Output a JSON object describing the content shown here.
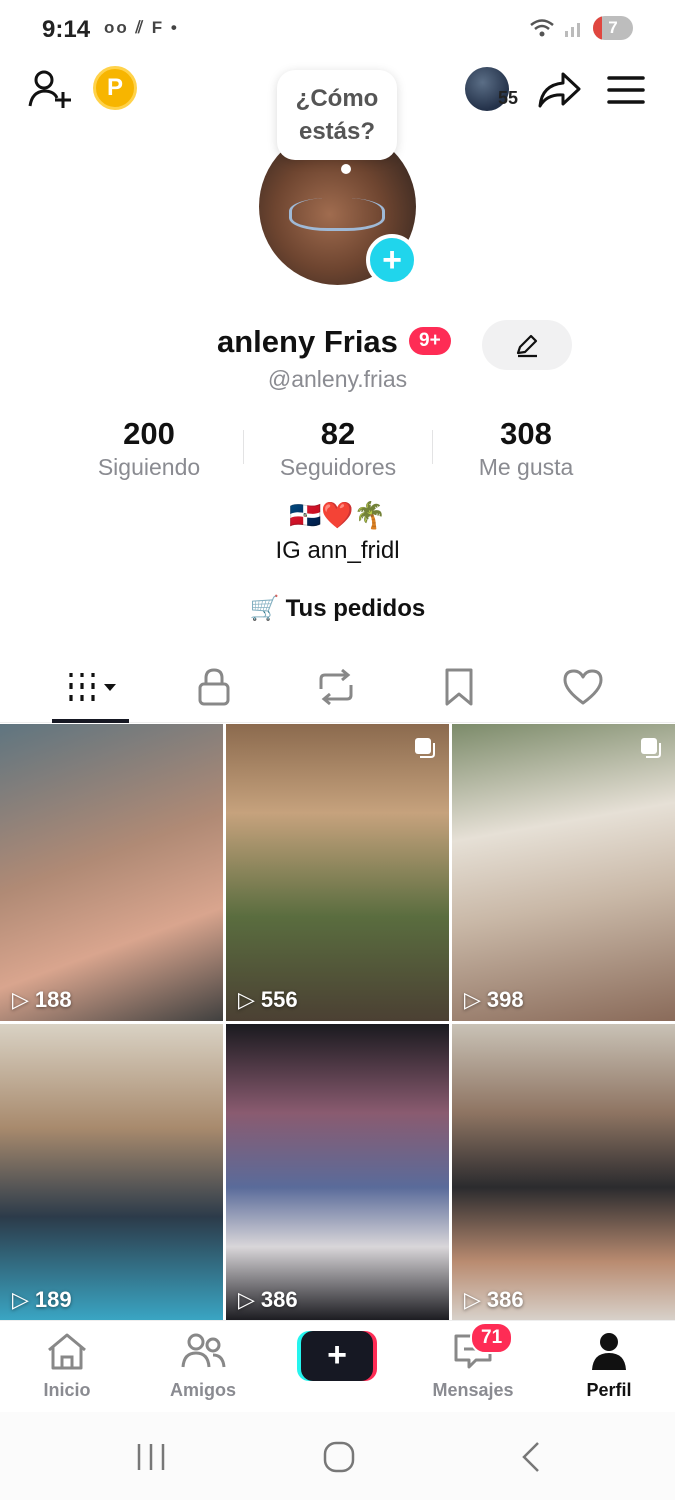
{
  "status_bar": {
    "time": "9:14",
    "left_icons": "oo ⫽ F •",
    "battery": "7"
  },
  "header": {
    "coin_label": "P",
    "visitors_count": "55"
  },
  "profile": {
    "bubble": "¿Cómo estás?",
    "name": "anleny Frias",
    "badge": "9+",
    "handle": "@anleny.frias"
  },
  "stats": [
    {
      "value": "200",
      "label": "Siguiendo"
    },
    {
      "value": "82",
      "label": "Seguidores"
    },
    {
      "value": "308",
      "label": "Me gusta"
    }
  ],
  "bio": {
    "emoji": "🇩🇴❤️🌴",
    "text": "IG ann_fridl"
  },
  "orders": {
    "label": "Tus pedidos"
  },
  "videos": [
    {
      "views": "188",
      "multi": false
    },
    {
      "views": "556",
      "multi": true
    },
    {
      "views": "398",
      "multi": true
    },
    {
      "views": "189",
      "multi": false
    },
    {
      "views": "386",
      "multi": false
    },
    {
      "views": "386",
      "multi": false
    }
  ],
  "bottom_nav": {
    "home": "Inicio",
    "friends": "Amigos",
    "inbox": "Mensajes",
    "inbox_badge": "71",
    "profile": "Perfil"
  },
  "colors": {
    "accent": "#fe2c55",
    "cyan": "#25f4ee",
    "story_add": "#20d5ec",
    "coin": "#f7b500"
  }
}
